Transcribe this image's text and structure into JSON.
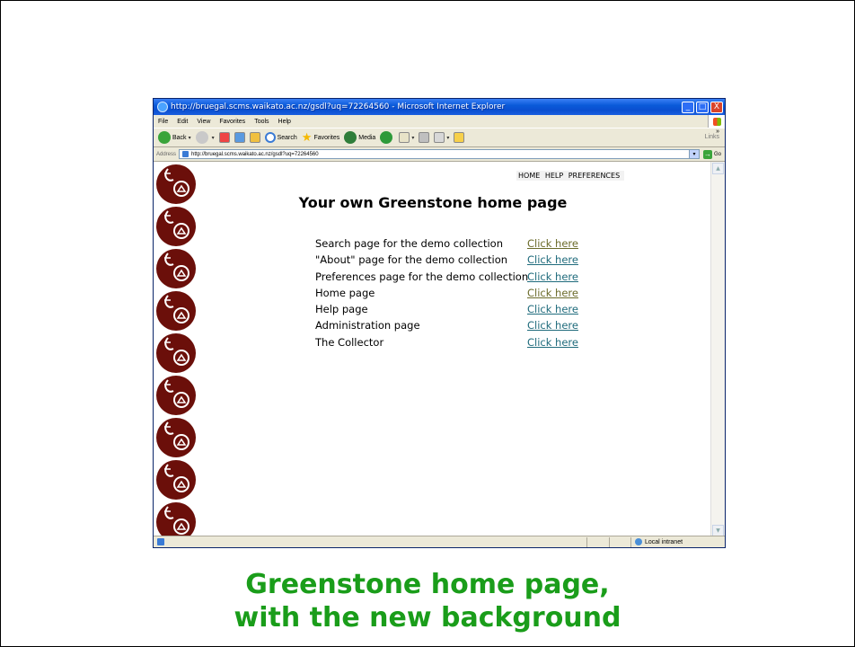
{
  "window": {
    "title": "http://bruegal.scms.waikato.ac.nz/gsdl?uq=72264560 - Microsoft Internet Explorer",
    "buttons": [
      "_",
      "□",
      "X"
    ]
  },
  "menubar": {
    "items": [
      {
        "label": "File"
      },
      {
        "label": "Edit"
      },
      {
        "label": "View"
      },
      {
        "label": "Favorites"
      },
      {
        "label": "Tools"
      },
      {
        "label": "Help"
      }
    ]
  },
  "toolbar": {
    "back_label": "Back",
    "search_label": "Search",
    "favorites_label": "Favorites",
    "media_label": "Media",
    "links_label": "Links",
    "chevron": "»"
  },
  "address": {
    "label": "Address",
    "url": "http://bruegal.scms.waikato.ac.nz/gsdl?uq=72264560",
    "go_label": "Go"
  },
  "page": {
    "nav": [
      "HOME",
      "HELP",
      "PREFERENCES"
    ],
    "heading": "Your own Greenstone home page",
    "link_text": "Click here",
    "rows": [
      {
        "desc": "Search page for the demo collection",
        "visited": true
      },
      {
        "desc": "\"About\" page for the demo collection",
        "visited": false
      },
      {
        "desc": "Preferences page for the demo collection",
        "visited": false
      },
      {
        "desc": "Home page",
        "visited": true
      },
      {
        "desc": "Help page",
        "visited": false
      },
      {
        "desc": "Administration page",
        "visited": false
      },
      {
        "desc": "The Collector",
        "visited": false
      }
    ],
    "logo_color": "#6b0f0a"
  },
  "statusbar": {
    "zone": "Local intranet"
  },
  "caption": {
    "line1": "Greenstone home page,",
    "line2": "with the new background",
    "color": "#1a9d1a"
  }
}
